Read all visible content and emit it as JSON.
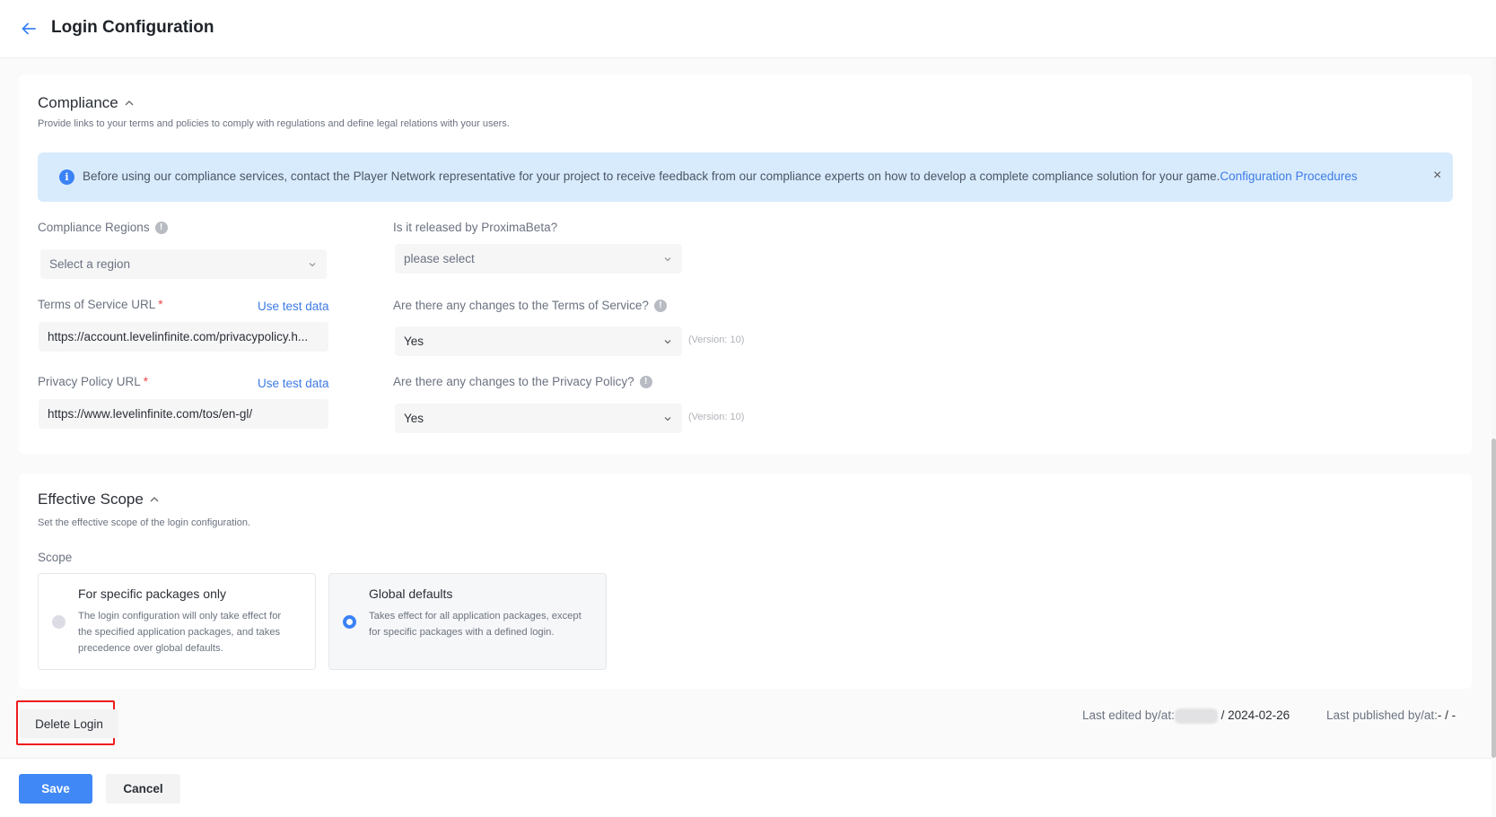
{
  "header": {
    "title": "Login Configuration",
    "back_icon": "arrow-left-icon"
  },
  "compliance": {
    "title": "Compliance",
    "description": "Provide links to your terms and policies to comply with regulations and define legal relations with your users.",
    "banner": {
      "text": "Before using our compliance services, contact the Player Network representative for your project to receive feedback from our compliance experts on how to develop a complete compliance solution for your game.",
      "link": "Configuration Procedures",
      "close": "×"
    },
    "regions": {
      "label": "Compliance Regions",
      "placeholder": "Select a region"
    },
    "tos": {
      "label": "Terms of Service URL",
      "required": "*",
      "use_test": "Use test data",
      "value": "https://account.levelinfinite.com/privacypolicy.h..."
    },
    "privacy": {
      "label": "Privacy Policy URL",
      "required": "*",
      "use_test": "Use test data",
      "value": "https://www.levelinfinite.com/tos/en-gl/"
    },
    "proxima": {
      "label": "Is it released by ProximaBeta?",
      "placeholder": "please select"
    },
    "tos_changes": {
      "label": "Are there any changes to the Terms of Service?",
      "value": "Yes",
      "version": "(Version: 10)"
    },
    "privacy_changes": {
      "label": "Are there any changes to the Privacy Policy?",
      "value": "Yes",
      "version": "(Version: 10)"
    }
  },
  "scope": {
    "title": "Effective Scope",
    "description": "Set the effective scope of the login configuration.",
    "label": "Scope",
    "options": [
      {
        "title": "For specific packages only",
        "desc": "The login configuration will only take effect for the specified application packages, and takes precedence over global defaults.",
        "selected": false
      },
      {
        "title": "Global defaults",
        "desc": "Takes effect for all application packages, except for specific packages with a defined login.",
        "selected": true
      }
    ]
  },
  "actions": {
    "delete": "Delete Login",
    "save": "Save",
    "cancel": "Cancel"
  },
  "meta": {
    "edited_label": "Last edited by/at:",
    "edited_date": "/ 2024-02-26",
    "published_label": "Last published by/at:",
    "published_value": "- / -"
  },
  "colors": {
    "accent": "#4088f5",
    "link": "#3d7be6",
    "banner_bg": "#d8ebfd",
    "highlight": "#ef1c1c"
  }
}
